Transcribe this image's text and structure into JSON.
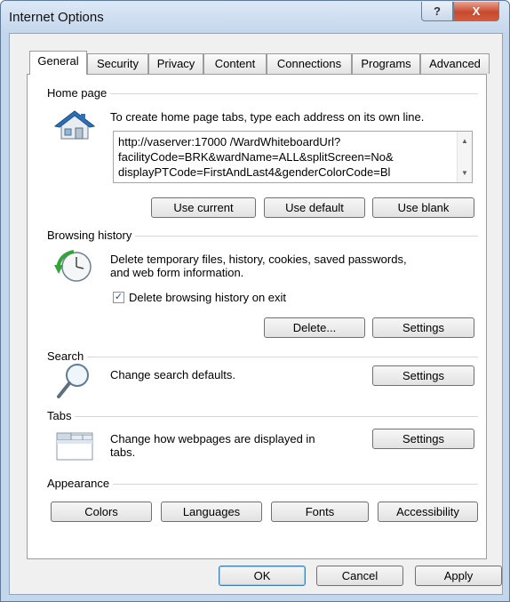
{
  "window": {
    "title": "Internet Options",
    "help_label": "?",
    "close_label": "X"
  },
  "tabs": [
    {
      "label": "General",
      "active": true
    },
    {
      "label": "Security"
    },
    {
      "label": "Privacy"
    },
    {
      "label": "Content"
    },
    {
      "label": "Connections"
    },
    {
      "label": "Programs"
    },
    {
      "label": "Advanced"
    }
  ],
  "home_page": {
    "title": "Home page",
    "description": "To create home page tabs, type each address on its own line.",
    "url_lines": [
      "http://vaserver:17000 /WardWhiteboardUrl?",
      "facilityCode=BRK&wardName=ALL&splitScreen=No&",
      "displayPTCode=FirstAndLast4&genderColorCode=Bl"
    ],
    "use_current": "Use current",
    "use_default": "Use default",
    "use_blank": "Use blank"
  },
  "browsing_history": {
    "title": "Browsing history",
    "description_line1": "Delete temporary files, history, cookies, saved passwords,",
    "description_line2": "and web form information.",
    "delete_on_exit_label": "Delete browsing history on exit",
    "delete_on_exit_checked": true,
    "delete_button": "Delete...",
    "settings_button": "Settings"
  },
  "search": {
    "title": "Search",
    "description": "Change search defaults.",
    "settings_button": "Settings"
  },
  "tabs_section": {
    "title": "Tabs",
    "description_line1": "Change how webpages are displayed in",
    "description_line2": "tabs.",
    "settings_button": "Settings"
  },
  "appearance": {
    "title": "Appearance",
    "colors": "Colors",
    "languages": "Languages",
    "fonts": "Fonts",
    "accessibility": "Accessibility"
  },
  "footer": {
    "ok": "OK",
    "cancel": "Cancel",
    "apply": "Apply"
  },
  "icons": {
    "home": "house-icon",
    "history": "clock-arrow-icon",
    "search": "magnifier-icon",
    "tabs": "tabbed-window-icon"
  }
}
